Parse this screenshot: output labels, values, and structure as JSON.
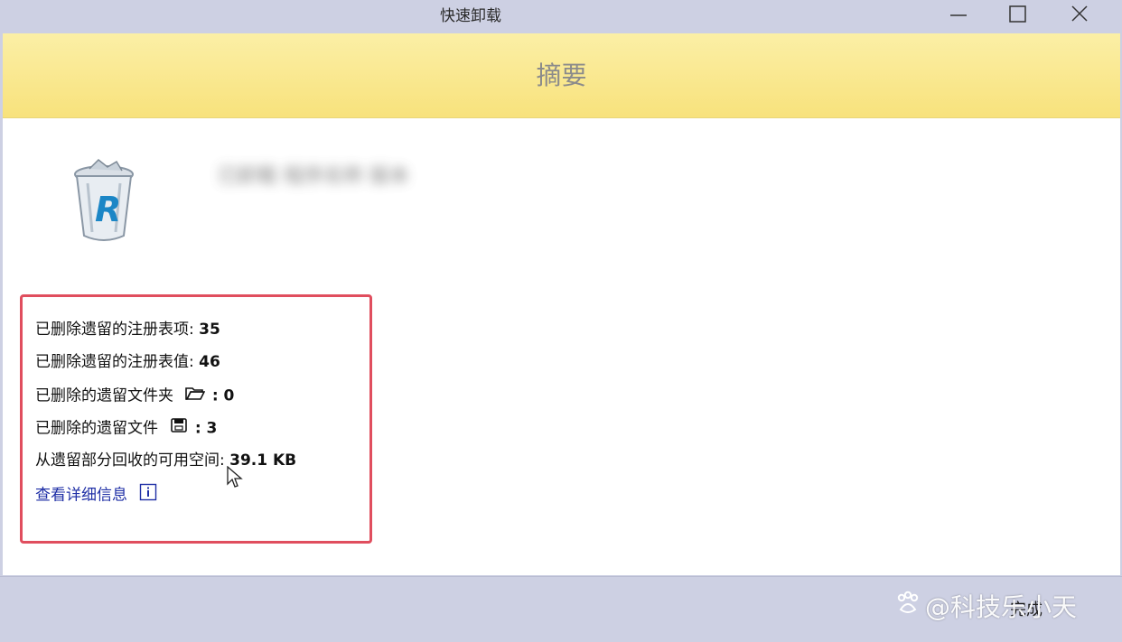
{
  "window": {
    "title": "快速卸载"
  },
  "header": {
    "title": "摘要"
  },
  "app": {
    "name": "已卸载 程序名称 版本",
    "icon": "recycle-bin-R-icon"
  },
  "summary": {
    "registry_keys_label": "已删除遗留的注册表项:",
    "registry_keys_value": "35",
    "registry_values_label": "已删除遗留的注册表值:",
    "registry_values_value": "46",
    "folders_label": "已删除的遗留文件夹",
    "folders_value": ": 0",
    "files_label": "已删除的遗留文件",
    "files_value": ": 3",
    "space_label": "从遗留部分回收的可用空间:",
    "space_value": "39.1 KB",
    "details_link": "查看详细信息"
  },
  "footer": {
    "finish_label": "完成",
    "watermark": "@科技乐小天"
  },
  "colors": {
    "titlebar": "#cdd0e3",
    "header_band": "#f8e27c",
    "highlight_box": "#e04e5e",
    "link": "#1f2fa6"
  }
}
